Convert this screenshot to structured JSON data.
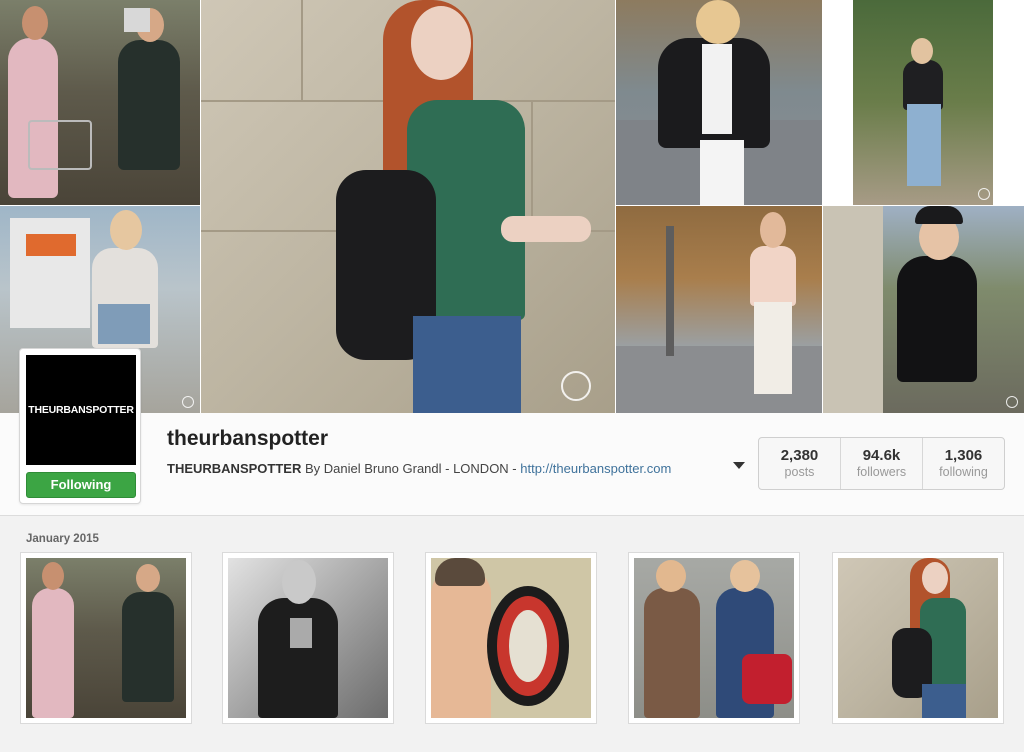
{
  "photos": {
    "main": "Street-style photo: red-haired model in green t-shirt with black backpack",
    "t1": "Two women in pink tweed with shopping baskets",
    "t2": "Woman in black jacket and white jeans on a street",
    "t3": "Woman in black jacket and jeans in autumn park",
    "t4": "Woman in sheer top and denim shorts by a truck",
    "t5": "Woman in pink blouse and white trousers, Paris street",
    "t6": "Woman in beret and black sweater with fringe sleeves"
  },
  "profile": {
    "avatar_text": "THEURBANSPOTTER",
    "follow_label": "Following",
    "username": "theurbanspotter",
    "bio_name": "THEURBANSPOTTER",
    "bio_text": " By Daniel Bruno Grandl - LONDON - ",
    "bio_link": "http://theurbanspotter.com"
  },
  "stats": [
    {
      "num": "2,380",
      "label": "posts"
    },
    {
      "num": "94.6k",
      "label": "followers"
    },
    {
      "num": "1,306",
      "label": "following"
    }
  ],
  "feed": {
    "month_label": "January 2015",
    "thumbs": [
      "Two women in pink tweed with baskets",
      "Black-and-white portrait of a woman in leather jacket",
      "Selfie of a man in front of a dartboard",
      "Two people in jackets and hats on a street",
      "Red-haired model with black backpack"
    ]
  },
  "colors": {
    "follow_green": "#3ca544",
    "link_blue": "#3f729b",
    "background": "#f2f2f2"
  }
}
